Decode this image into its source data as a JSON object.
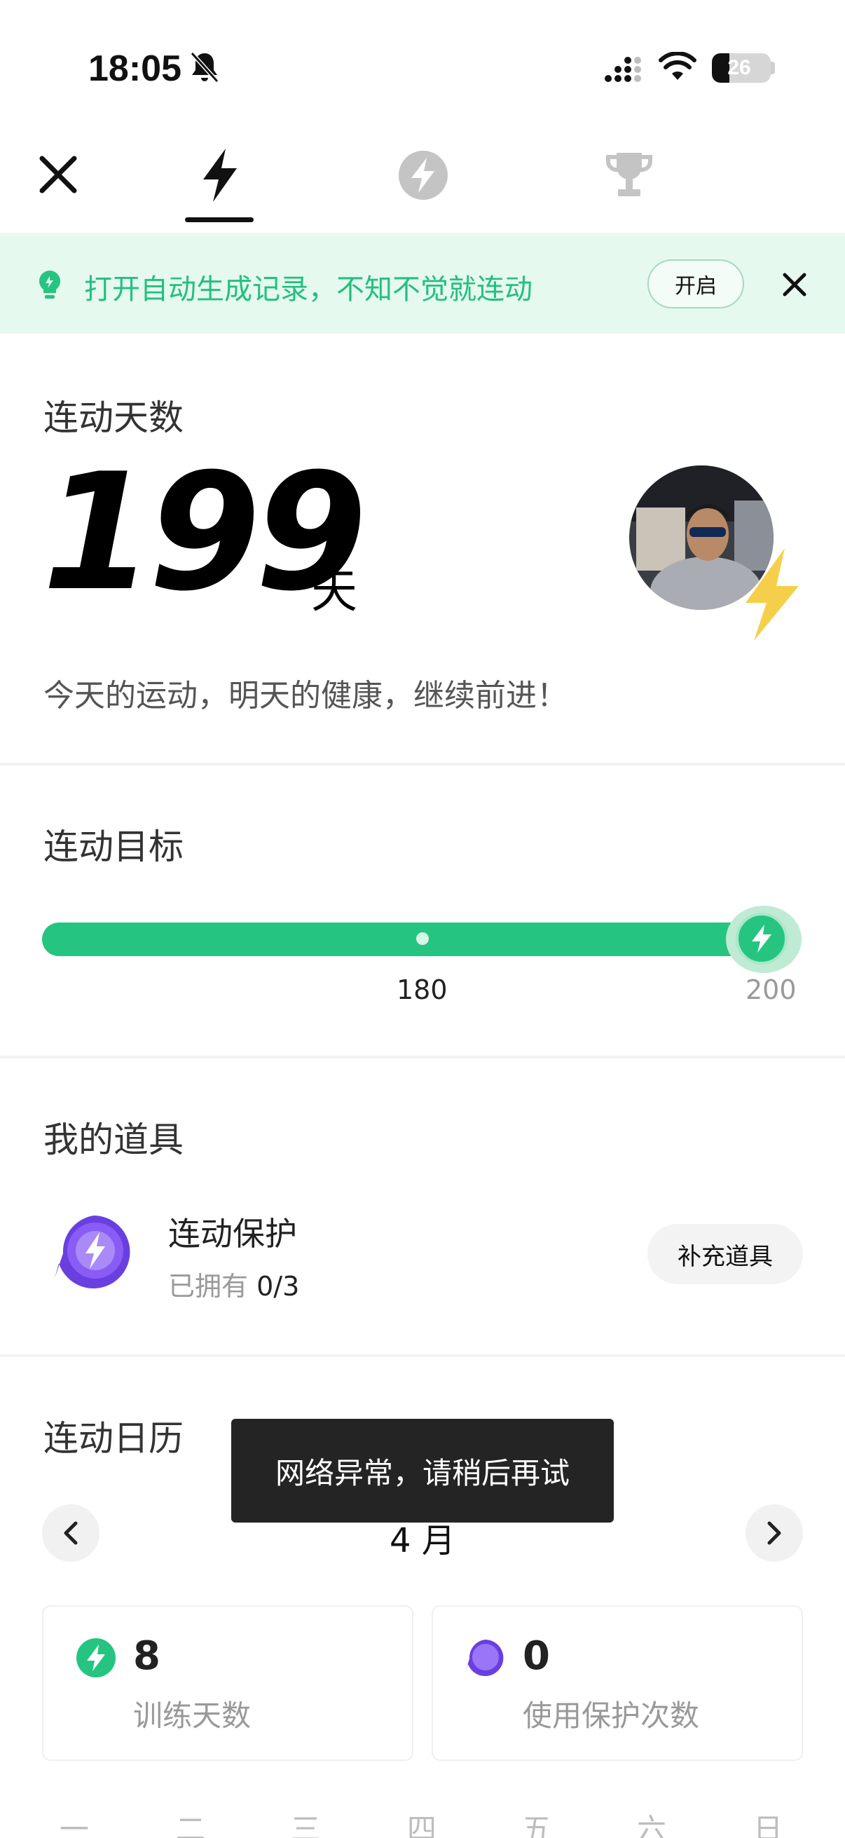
{
  "status_bar": {
    "time": "18:05",
    "battery": "26",
    "icons": [
      "bell-off-icon",
      "signal-icon",
      "wifi-icon",
      "battery-icon"
    ]
  },
  "top_tabs": [
    {
      "name": "streak",
      "icon": "lightning-icon",
      "active": true
    },
    {
      "name": "energy",
      "icon": "lightning-circle-icon",
      "active": false
    },
    {
      "name": "trophy",
      "icon": "trophy-icon",
      "active": false
    }
  ],
  "banner": {
    "text": "打开自动生成记录，不知不觉就连动",
    "button": "开启"
  },
  "streak": {
    "label": "连动天数",
    "days": "199",
    "unit": "天",
    "motto": "今天的运动，明天的健康，继续前进！"
  },
  "goal": {
    "label": "连动目标",
    "milestone": "180",
    "target": "200",
    "progress_ratio": 0.995
  },
  "props": {
    "label": "我的道具",
    "item_name": "连动保护",
    "owned_prefix": "已拥有",
    "owned_value": "0/3",
    "button": "补充道具"
  },
  "calendar": {
    "label": "连动日历",
    "month": "4 月",
    "stats": [
      {
        "value": "8",
        "label": "训练天数"
      },
      {
        "value": "0",
        "label": "使用保护次数"
      }
    ],
    "weekdays": [
      "一",
      "二",
      "三",
      "四",
      "五",
      "六",
      "日"
    ]
  },
  "toast": {
    "message": "网络异常，请稍后再试"
  },
  "colors": {
    "accent_green": "#25c581",
    "banner_bg": "#e6f9ef",
    "shield_purple": "#7a4cf0",
    "bolt_yellow": "#f6cf4a"
  }
}
